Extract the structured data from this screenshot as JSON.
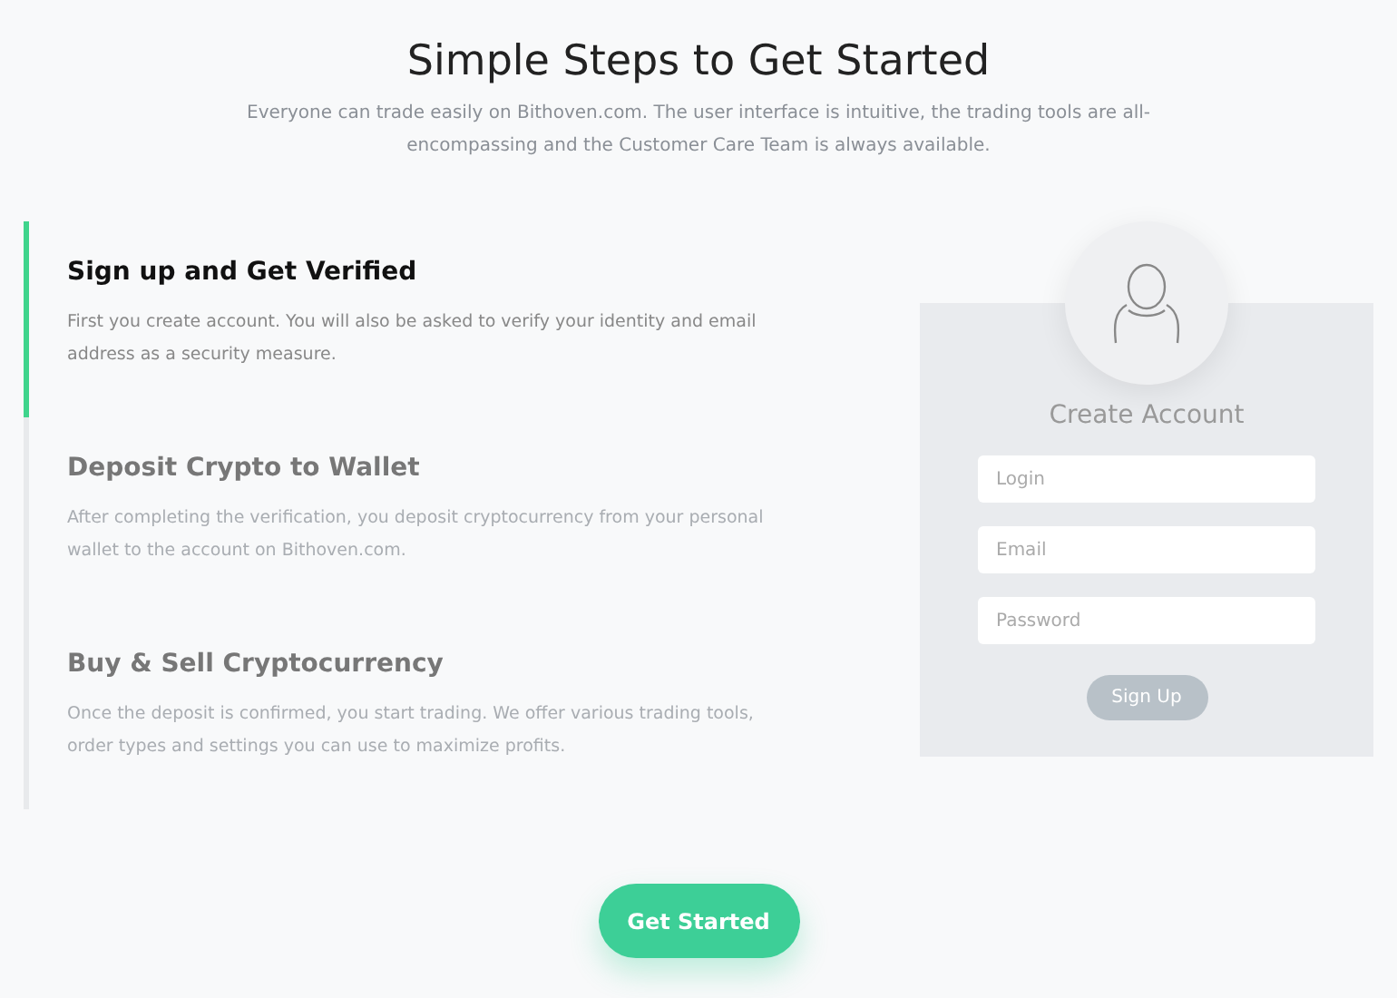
{
  "header": {
    "title": "Simple Steps to Get Started",
    "subtitle": "Everyone can trade easily on Bithoven.com. The user interface is intuitive, the trading tools are all-encompassing and the Customer Care Team is always available."
  },
  "steps": [
    {
      "title": "Sign up and Get Verified",
      "text": "First you create account. You will also be asked to verify your identity and email address as a security measure.",
      "selected": true
    },
    {
      "title": "Deposit Crypto to Wallet",
      "text": "After completing the verification, you deposit cryptocurrency from your personal wallet to the account on Bithoven.com.",
      "selected": false
    },
    {
      "title": "Buy & Sell Cryptocurrency",
      "text": "Once the deposit is confirmed, you start trading. We offer various trading tools, order types and settings you can use to maximize profits.",
      "selected": false
    }
  ],
  "signup_card": {
    "title": "Create Account",
    "fields": [
      {
        "placeholder": "Login"
      },
      {
        "placeholder": "Email"
      },
      {
        "placeholder": "Password"
      }
    ],
    "button": "Sign Up"
  },
  "cta_button": "Get Started"
}
